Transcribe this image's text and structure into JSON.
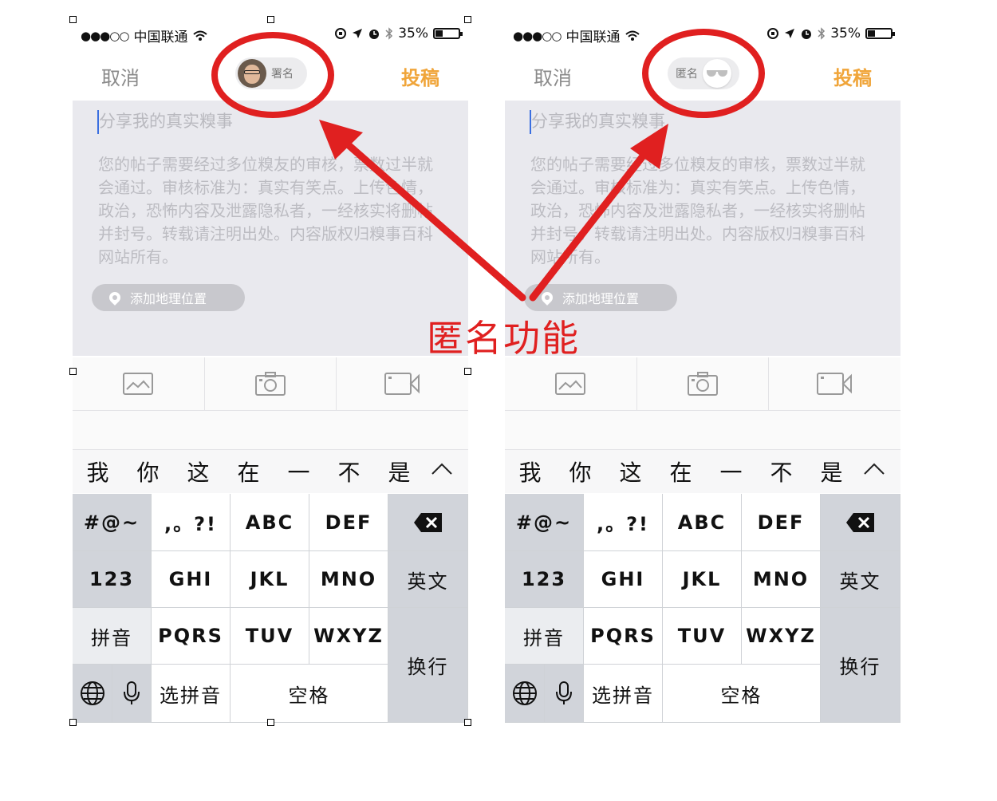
{
  "status": {
    "carrier": "中国联通",
    "battery": "35%"
  },
  "nav": {
    "cancel": "取消",
    "submit": "投稿",
    "signed_label": "署名",
    "anonymous_label": "匿名"
  },
  "compose": {
    "placeholder": "分享我的真实糗事",
    "rules": "您的帖子需要经过多位糗友的审核，票数过半就会通过。审核标准为：真实有笑点。上传色情，政治，恐怖内容及泄露隐私者，一经核实将删帖并封号。转载请注明出处。内容版权归糗事百科网站所有。",
    "add_location": "添加地理位置"
  },
  "keyboard": {
    "candidates": [
      "我",
      "你",
      "这",
      "在",
      "一",
      "不",
      "是"
    ],
    "row1": [
      "#@~",
      ",。?!",
      "ABC",
      "DEF"
    ],
    "row2": [
      "123",
      "GHI",
      "JKL",
      "MNO",
      "英文"
    ],
    "row3": [
      "拼音",
      "PQRS",
      "TUV",
      "WXYZ"
    ],
    "return": "换行",
    "select_pinyin": "选拼音",
    "space": "空格"
  },
  "annotation": {
    "text": "匿名功能",
    "color": "#e02020"
  },
  "colors": {
    "accent": "#f0a53a",
    "compose_bg": "#e9e9ee",
    "keyboard_bg": "#d1d4da"
  },
  "icons": [
    "wifi-icon",
    "orientation-lock-icon",
    "location-arrow-icon",
    "alarm-icon",
    "bluetooth-icon",
    "battery-icon",
    "map-pin-icon",
    "image-icon",
    "camera-icon",
    "video-icon",
    "chevron-up-icon",
    "delete-icon",
    "globe-icon",
    "microphone-icon",
    "sunglasses-icon"
  ]
}
